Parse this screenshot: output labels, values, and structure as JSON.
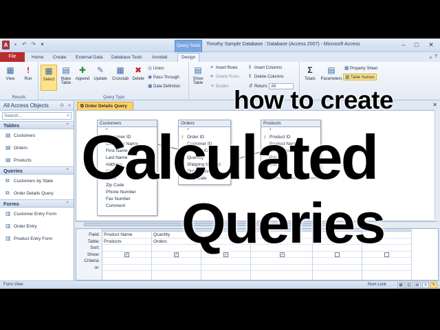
{
  "window": {
    "title": "Timothy Sample Database : Database (Access 2007) - Microsoft Access",
    "context_tab_label": "Query Tools",
    "app_icon_letter": "A",
    "minimize": "–",
    "maximize": "□",
    "close": "✕"
  },
  "ribbon_tabs": {
    "file": "File",
    "items": [
      "Home",
      "Create",
      "External Data",
      "Database Tools",
      "Acrobat",
      "Design"
    ]
  },
  "ribbon": {
    "results": {
      "label": "Results",
      "view": "View",
      "run": "Run"
    },
    "query_type": {
      "label": "Query Type",
      "select": "Select",
      "make_table_1": "Make",
      "make_table_2": "Table",
      "append": "Append",
      "update": "Update",
      "crosstab": "Crosstab",
      "delete": "Delete",
      "union": "Union",
      "pass_through": "Pass-Through",
      "data_definition": "Data Definition"
    },
    "setup": {
      "show_table_1": "Show",
      "show_table_2": "Table",
      "insert_rows": "Insert Rows",
      "delete_rows": "Delete Rows",
      "builder": "Builder",
      "insert_columns": "Insert Columns",
      "delete_columns": "Delete Columns",
      "return_label": "Return:",
      "return_value": "All"
    },
    "show_hide": {
      "totals": "Totals",
      "parameters": "Parameters",
      "property_sheet": "Property Sheet",
      "table_names": "Table Names"
    }
  },
  "nav": {
    "header": "All Access Objects",
    "search_placeholder": "Search...",
    "groups": [
      {
        "title": "Tables",
        "items": [
          "Customers",
          "Orders",
          "Products"
        ]
      },
      {
        "title": "Queries",
        "items": [
          "Customers by State",
          "Order Details Query"
        ]
      },
      {
        "title": "Forms",
        "items": [
          "Customer Entry Form",
          "Order Entry",
          "Product Entry Form"
        ]
      }
    ]
  },
  "document": {
    "tab_label": "Order Details Query",
    "close": "✕"
  },
  "tables": {
    "customers": {
      "title": "Customers",
      "fields": [
        "*",
        "Customer ID",
        "Company Name",
        "First Name",
        "Last Name",
        "Address",
        "City",
        "State",
        "Zip Code",
        "Phone Number",
        "Fax Number",
        "Comment"
      ]
    },
    "orders": {
      "title": "Orders",
      "fields": [
        "*",
        "Order ID",
        "Customer ID",
        "Product ID",
        "Quantity",
        "Shipping Method",
        "Order Date",
        "Ship Date"
      ]
    },
    "products": {
      "title": "Products",
      "fields": [
        "*",
        "Product ID",
        "Product Name",
        "Description",
        "Price",
        "Category"
      ]
    }
  },
  "grid": {
    "row_labels": [
      "Field:",
      "Table:",
      "Sort:",
      "Show:",
      "Criteria:",
      "or:"
    ],
    "columns": [
      {
        "field": "Product Name",
        "table": "Products",
        "show": true
      },
      {
        "field": "Quantity",
        "table": "Orders",
        "show": true
      },
      {
        "field": "",
        "table": "",
        "show": true
      },
      {
        "field": "",
        "table": "",
        "show": true
      },
      {
        "field": "",
        "table": "",
        "show": false
      },
      {
        "field": "",
        "table": "",
        "show": false
      }
    ]
  },
  "status": {
    "left": "Form View",
    "right": "Num Lock"
  },
  "overlay": {
    "line1": "how to create",
    "line2": "Calculated",
    "line3": "Queries"
  }
}
